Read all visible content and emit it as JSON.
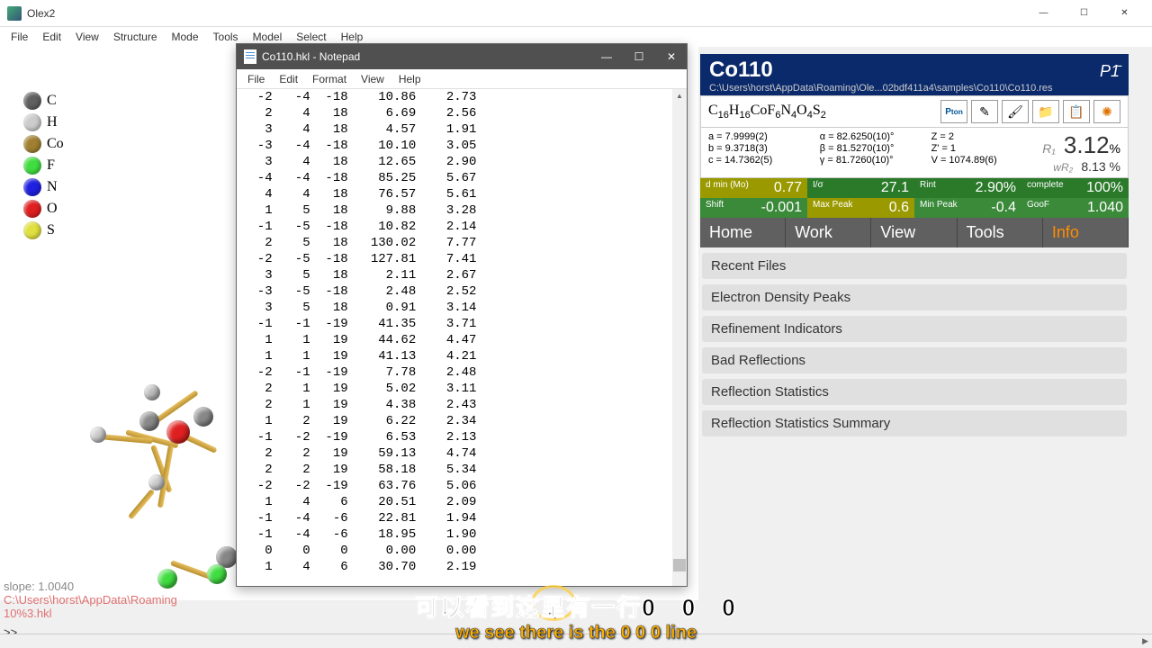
{
  "olex": {
    "title": "Olex2",
    "menus": [
      "File",
      "Edit",
      "View",
      "Structure",
      "Mode",
      "Tools",
      "Model",
      "Select",
      "Help"
    ],
    "legend": [
      {
        "label": "C",
        "color": "#606060"
      },
      {
        "label": "H",
        "color": "#cccccc"
      },
      {
        "label": "Co",
        "color": "#a08030"
      },
      {
        "label": "F",
        "color": "#40dd40"
      },
      {
        "label": "N",
        "color": "#2020e0"
      },
      {
        "label": "O",
        "color": "#e02020"
      },
      {
        "label": "S",
        "color": "#e0e040"
      }
    ],
    "console_line1": "slope: 1.0040",
    "console_line2": "C:\\Users\\horst\\AppData\\Roaming\n10%3.hkl",
    "prompt": ">>"
  },
  "notepad": {
    "title": "Co110.hkl - Notepad",
    "menus": [
      "File",
      "Edit",
      "Format",
      "View",
      "Help"
    ],
    "rows": [
      [
        -2,
        -4,
        -18,
        "10.86",
        "2.73"
      ],
      [
        2,
        4,
        18,
        "6.69",
        "2.56"
      ],
      [
        3,
        4,
        18,
        "4.57",
        "1.91"
      ],
      [
        -3,
        -4,
        -18,
        "10.10",
        "3.05"
      ],
      [
        3,
        4,
        18,
        "12.65",
        "2.90"
      ],
      [
        -4,
        -4,
        -18,
        "85.25",
        "5.67"
      ],
      [
        4,
        4,
        18,
        "76.57",
        "5.61"
      ],
      [
        1,
        5,
        18,
        "9.88",
        "3.28"
      ],
      [
        -1,
        -5,
        -18,
        "10.82",
        "2.14"
      ],
      [
        2,
        5,
        18,
        "130.02",
        "7.77"
      ],
      [
        -2,
        -5,
        -18,
        "127.81",
        "7.41"
      ],
      [
        3,
        5,
        18,
        "2.11",
        "2.67"
      ],
      [
        -3,
        -5,
        -18,
        "2.48",
        "2.52"
      ],
      [
        3,
        5,
        18,
        "0.91",
        "3.14"
      ],
      [
        -1,
        -1,
        -19,
        "41.35",
        "3.71"
      ],
      [
        1,
        1,
        19,
        "44.62",
        "4.47"
      ],
      [
        1,
        1,
        19,
        "41.13",
        "4.21"
      ],
      [
        -2,
        -1,
        -19,
        "7.78",
        "2.48"
      ],
      [
        2,
        1,
        19,
        "5.02",
        "3.11"
      ],
      [
        2,
        1,
        19,
        "4.38",
        "2.43"
      ],
      [
        1,
        2,
        19,
        "6.22",
        "2.34"
      ],
      [
        -1,
        -2,
        -19,
        "6.53",
        "2.13"
      ],
      [
        2,
        2,
        19,
        "59.13",
        "4.74"
      ],
      [
        2,
        2,
        19,
        "58.18",
        "5.34"
      ],
      [
        -2,
        -2,
        -19,
        "63.76",
        "5.06"
      ],
      [
        1,
        4,
        6,
        "20.51",
        "2.09"
      ],
      [
        -1,
        -4,
        -6,
        "22.81",
        "1.94"
      ],
      [
        -1,
        -4,
        -6,
        "18.95",
        "1.90"
      ],
      [
        0,
        0,
        0,
        "0.00",
        "0.00"
      ],
      [
        1,
        4,
        6,
        "30.70",
        "2.19"
      ]
    ]
  },
  "panel": {
    "title": "Co110",
    "spacegroup": "P1̄",
    "path": "C:\\Users\\horst\\AppData\\Roaming\\Ole...02bdf411a4\\samples\\Co110\\Co110.res",
    "formula_html": "C<sub>16</sub>H<sub>16</sub>CoF<sub>6</sub>N<sub>4</sub>O<sub>4</sub>S<sub>2</sub>",
    "cell": {
      "a": "a = 7.9999(2)",
      "alpha": "α = 82.6250(10)°",
      "z": "Z = 2",
      "b": "b = 9.3718(3)",
      "beta": "β = 81.5270(10)°",
      "zp": "Z' = 1",
      "c": "c = 14.7362(5)",
      "gamma": "γ = 81.7260(10)°",
      "v": "V = 1074.89(6)"
    },
    "r1_label": "R₁",
    "r1": "3.12",
    "r1_pct": "%",
    "wr2_label": "wR₂",
    "wr2": "8.13 %",
    "stats": [
      {
        "lbl": "d min (Mo)",
        "val": "0.77",
        "cls": "bg-yellow"
      },
      {
        "lbl": "I/σ",
        "val": "27.1",
        "cls": "bg-green"
      },
      {
        "lbl": "Rint",
        "val": "2.90%",
        "cls": "bg-green"
      },
      {
        "lbl": "complete",
        "val": "100%",
        "cls": "bg-green"
      },
      {
        "lbl": "Shift",
        "val": "-0.001",
        "cls": "bg-lgreen"
      },
      {
        "lbl": "Max Peak",
        "val": "0.6",
        "cls": "bg-yellow"
      },
      {
        "lbl": "Min Peak",
        "val": "-0.4",
        "cls": "bg-lgreen"
      },
      {
        "lbl": "GooF",
        "val": "1.040",
        "cls": "bg-lgreen"
      }
    ],
    "tabs": [
      "Home",
      "Work",
      "View",
      "Tools",
      "Info"
    ],
    "active_tab": 4,
    "sections": [
      "Recent Files",
      "Electron Density Peaks",
      "Refinement Indicators",
      "Bad Reflections",
      "Reflection Statistics",
      "Reflection Statistics Summary"
    ]
  },
  "subtitles": {
    "cn": "可以看到这里有一行0　0　0",
    "en": "we see there is the 0 0 0 line"
  }
}
